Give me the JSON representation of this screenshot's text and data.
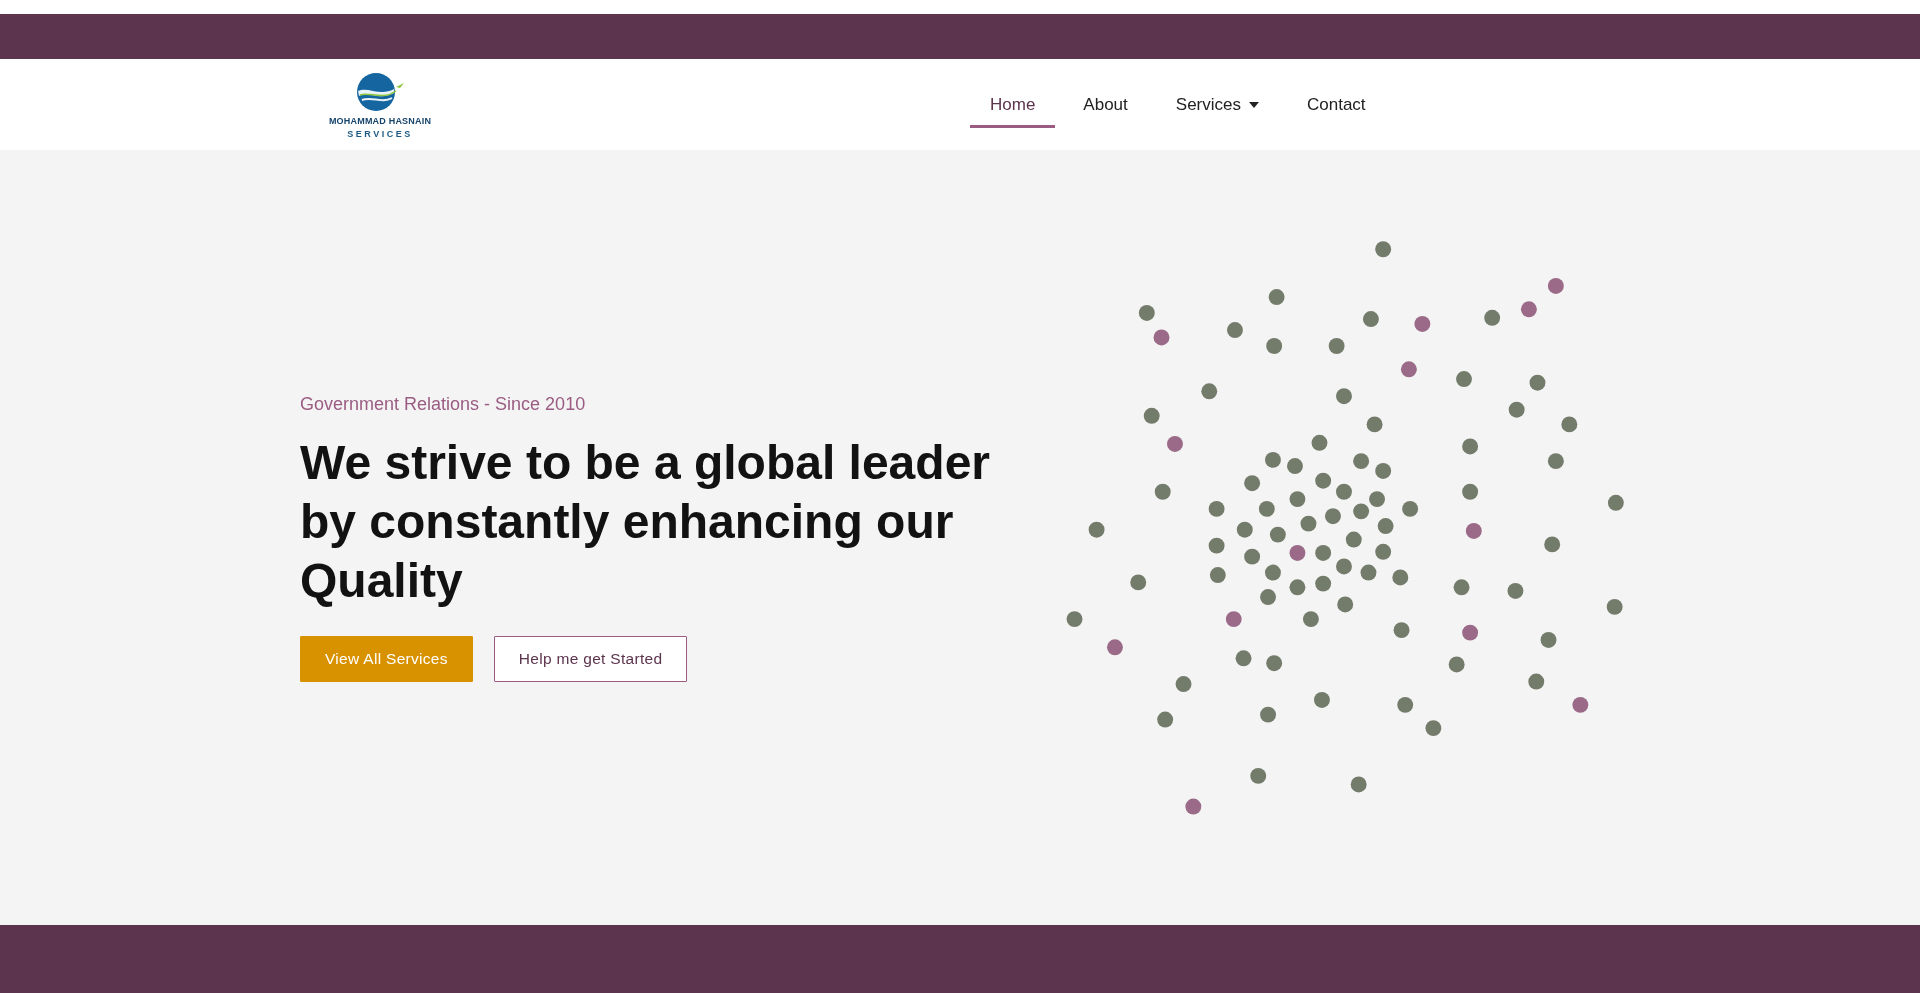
{
  "logo": {
    "name": "MOHAMMAD HASNAIN",
    "tagline": "SERVICES"
  },
  "nav": [
    {
      "label": "Home",
      "selected": true,
      "has_dropdown": false
    },
    {
      "label": "About",
      "selected": false,
      "has_dropdown": false
    },
    {
      "label": "Services",
      "selected": false,
      "has_dropdown": true
    },
    {
      "label": "Contact",
      "selected": false,
      "has_dropdown": false
    }
  ],
  "hero": {
    "eyebrow": "Government Relations - Since 2010",
    "heading": "We strive to be a global leader by constantly enhancing our Quality",
    "buttons": [
      {
        "label": "View All Services",
        "kind": "primary"
      },
      {
        "label": "Help me get Started",
        "kind": "outline"
      }
    ]
  }
}
